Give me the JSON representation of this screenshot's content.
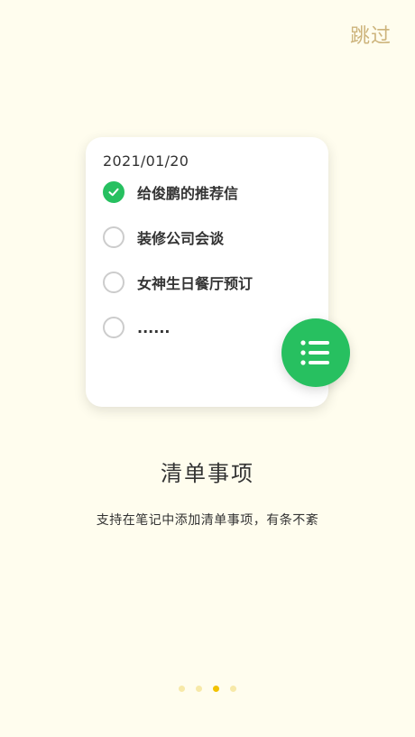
{
  "skip_label": "跳过",
  "card": {
    "date": "2021/01/20",
    "items": [
      {
        "text": "给俊鹏的推荐信",
        "checked": true
      },
      {
        "text": "装修公司会谈",
        "checked": false
      },
      {
        "text": "女神生日餐厅预订",
        "checked": false
      },
      {
        "text": "......",
        "checked": false
      }
    ]
  },
  "fab_icon": "list-icon",
  "feature": {
    "title": "清单事项",
    "description": "支持在笔记中添加清单事项，有条不紊"
  },
  "pager": {
    "total": 4,
    "active_index": 2
  },
  "colors": {
    "background": "#FFFDEE",
    "accent_green": "#27C060",
    "skip_gold": "#CDB47C",
    "dot_active": "#F2C200",
    "dot_inactive": "#F7E9A8"
  }
}
